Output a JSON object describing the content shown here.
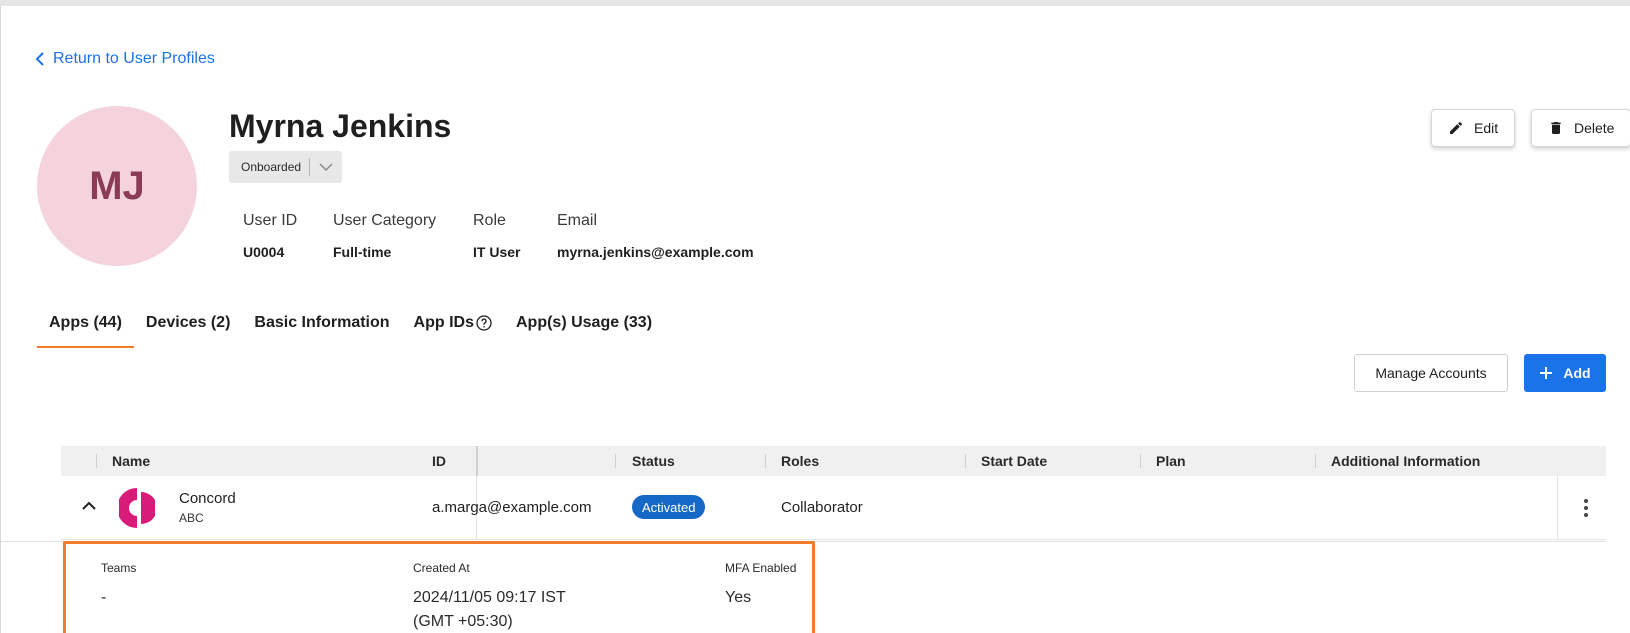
{
  "back_link": {
    "label": "Return to User Profiles"
  },
  "profile": {
    "initials": "MJ",
    "name": "Myrna Jenkins",
    "status": "Onboarded",
    "fields": [
      {
        "label": "User ID",
        "value": "U0004"
      },
      {
        "label": "User Category",
        "value": "Full-time"
      },
      {
        "label": "Role",
        "value": "IT User"
      },
      {
        "label": "Email",
        "value": "myrna.jenkins@example.com"
      }
    ]
  },
  "actions": {
    "edit": "Edit",
    "delete": "Delete"
  },
  "tabs": [
    {
      "label": "Apps (44)",
      "active": true
    },
    {
      "label": "Devices (2)"
    },
    {
      "label": "Basic Information"
    },
    {
      "label": "App IDs"
    },
    {
      "label": "App(s) Usage (33)"
    }
  ],
  "toolbar": {
    "manage_accounts": "Manage Accounts",
    "add": "Add"
  },
  "table": {
    "columns": [
      "Name",
      "ID",
      "Status",
      "Roles",
      "Start Date",
      "Plan",
      "Additional Information"
    ],
    "rows": [
      {
        "name": "Concord",
        "org": "ABC",
        "id": "a.marga@example.com",
        "status": "Activated",
        "roles": "Collaborator",
        "start_date": "",
        "plan": "",
        "additional_information": ""
      }
    ]
  },
  "expanded_details": [
    {
      "label": "Teams",
      "value": "-"
    },
    {
      "label": "Created At",
      "value": "2024/11/05 09:17 IST\n(GMT +05:30)"
    },
    {
      "label": "MFA Enabled",
      "value": "Yes"
    }
  ],
  "colors": {
    "accent_blue": "#1a73e8",
    "tab_indicator": "#f07c2c",
    "highlight_border": "#f07c2c",
    "avatar_bg": "#f5d3dd",
    "avatar_text": "#8a3b55",
    "status_badge": "#1668c7",
    "app_logo": "#d81b78"
  },
  "icons": {
    "back": "chevron-left-icon",
    "edit": "pencil-icon",
    "delete": "trash-icon",
    "status_dropdown": "chevron-down-icon",
    "help": "question-circle-icon",
    "add": "plus-icon",
    "expand": "chevron-up-icon",
    "row_menu": "more-vertical-icon"
  }
}
